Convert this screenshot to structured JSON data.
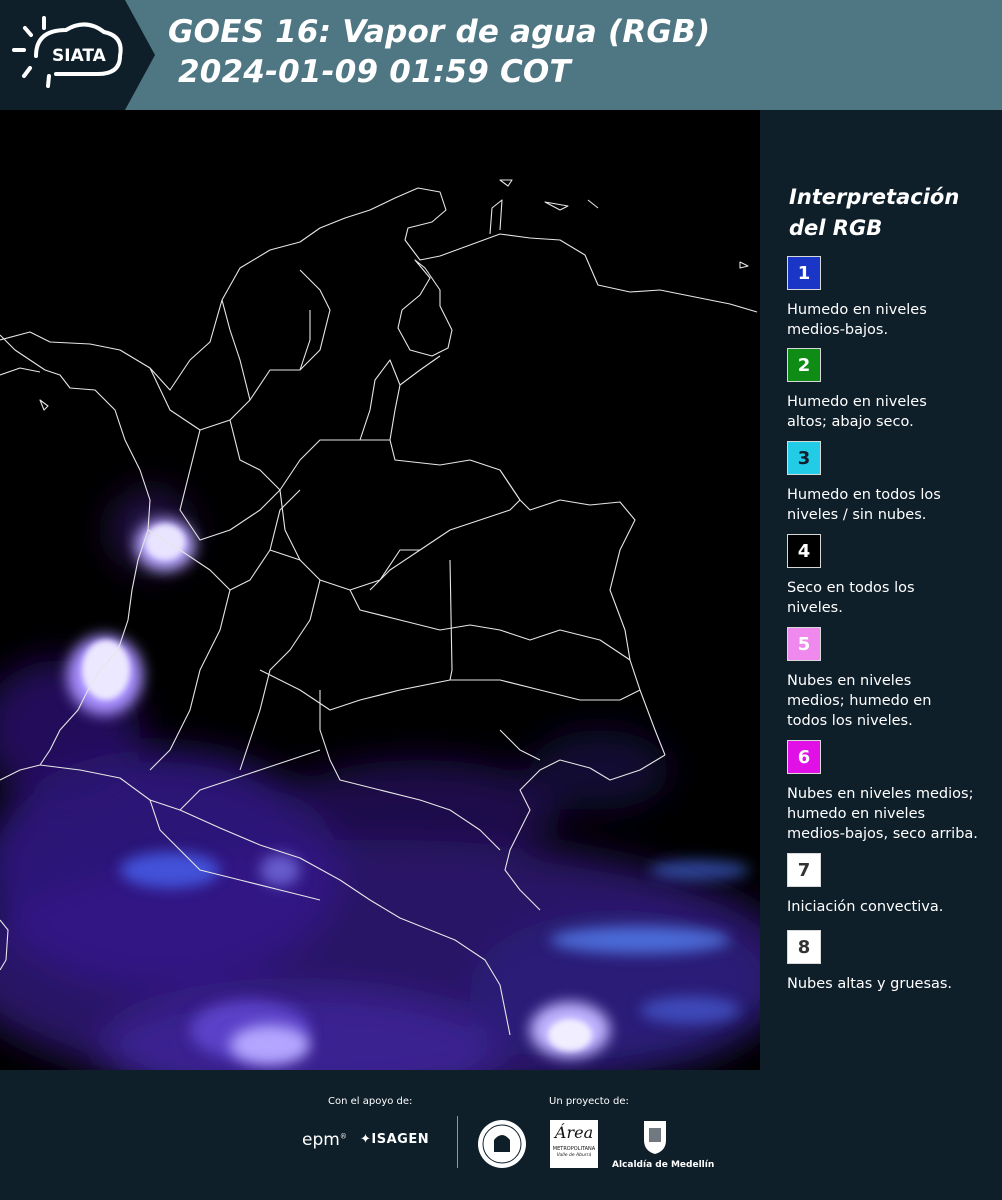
{
  "header": {
    "brand": "SIATA",
    "title_line1": "GOES 16: Vapor de agua (RGB)",
    "title_line2": "2024-01-09 01:59 COT"
  },
  "legend": {
    "title_line1": "Interpretación",
    "title_line2": "del RGB",
    "items": [
      {
        "number": "1",
        "color": "#1a36c6",
        "text_color": "#ffffff",
        "lines": [
          "Humedo en niveles",
          "medios-bajos."
        ]
      },
      {
        "number": "2",
        "color": "#0f8c16",
        "text_color": "#ffffff",
        "lines": [
          "Humedo en niveles",
          "altos; abajo seco."
        ]
      },
      {
        "number": "3",
        "color": "#22cbe6",
        "text_color": "#0f1f2a",
        "lines": [
          "Humedo en todos los",
          "niveles / sin nubes."
        ]
      },
      {
        "number": "4",
        "color": "#000000",
        "text_color": "#ffffff",
        "lines": [
          "Seco en todos los",
          "niveles."
        ]
      },
      {
        "number": "5",
        "color": "#f089ee",
        "text_color": "#ffffff",
        "lines": [
          "Nubes en niveles",
          "medios; humedo en",
          "todos los niveles."
        ]
      },
      {
        "number": "6",
        "color": "#e010e6",
        "text_color": "#ffffff",
        "lines": [
          "Nubes en niveles medios;",
          "humedo en niveles",
          "medios-bajos, seco arriba."
        ]
      },
      {
        "number": "7",
        "color": "#ffffff",
        "text_color": "#333333",
        "lines": [
          "Iniciación convectiva."
        ]
      },
      {
        "number": "8",
        "color": "#ffffff",
        "text_color": "#333333",
        "lines": [
          "Nubes altas y gruesas."
        ]
      }
    ]
  },
  "footer": {
    "support_label": "Con el apoyo de:",
    "project_label": "Un proyecto de:",
    "sponsor1": "epm",
    "sponsor2": "ISAGEN",
    "partner_area_line1": "METROPOLITANA",
    "partner_area_line2": "Valle de Aburrá",
    "partner_area_word": "Área",
    "partner_alcaldia": "Alcaldía de Medellín"
  },
  "colors": {
    "header_bg": "#4f7683",
    "panel_bg": "#0f1f2a",
    "map_bg": "#000000",
    "borders": "#e6e6e6"
  }
}
